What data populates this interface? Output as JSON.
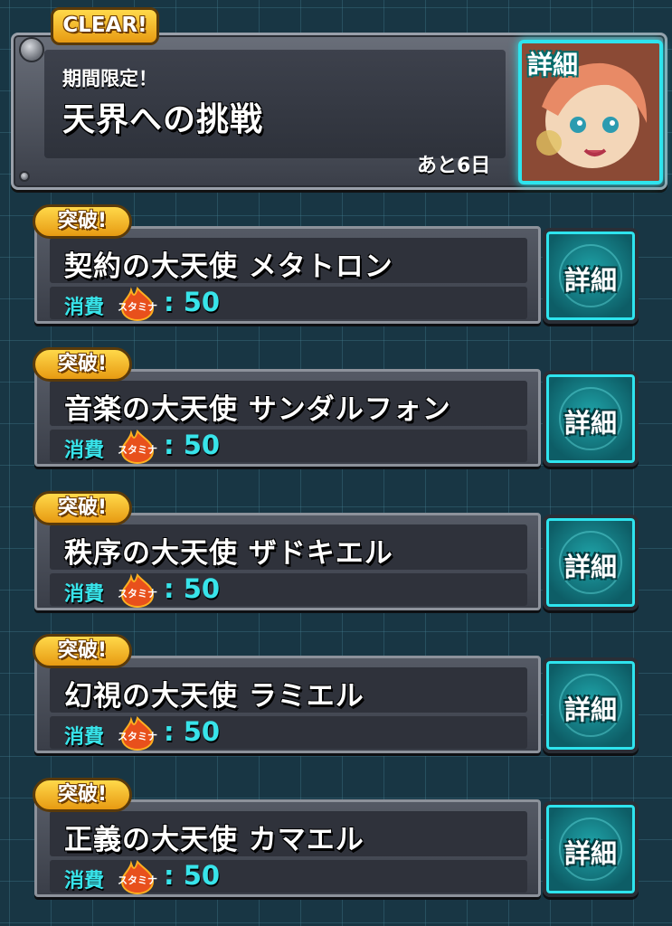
{
  "event": {
    "badge": "CLEAR!",
    "subtitle": "期間限定！",
    "title": "天界への挑戦",
    "remaining": "あと6日",
    "detail_label": "詳細"
  },
  "quests": [
    {
      "badge": "突破!",
      "name": "契約の大天使 メタトロン",
      "stamina_label": "消費",
      "stamina_icon_text": "スタミナ",
      "stamina_value": ": 50",
      "detail_label": "詳細"
    },
    {
      "badge": "突破!",
      "name": "音楽の大天使 サンダルフォン",
      "stamina_label": "消費",
      "stamina_icon_text": "スタミナ",
      "stamina_value": ": 50",
      "detail_label": "詳細"
    },
    {
      "badge": "突破!",
      "name": "秩序の大天使 ザドキエル",
      "stamina_label": "消費",
      "stamina_icon_text": "スタミナ",
      "stamina_value": ": 50",
      "detail_label": "詳細"
    },
    {
      "badge": "突破!",
      "name": "幻視の大天使 ラミエル",
      "stamina_label": "消費",
      "stamina_icon_text": "スタミナ",
      "stamina_value": ": 50",
      "detail_label": "詳細"
    },
    {
      "badge": "突破!",
      "name": "正義の大天使 カマエル",
      "stamina_label": "消費",
      "stamina_icon_text": "スタミナ",
      "stamina_value": ": 50",
      "detail_label": "詳細"
    }
  ],
  "colors": {
    "background": "#183644",
    "accent_cyan": "#38e4ea",
    "badge_gold": "#ffd94a"
  }
}
